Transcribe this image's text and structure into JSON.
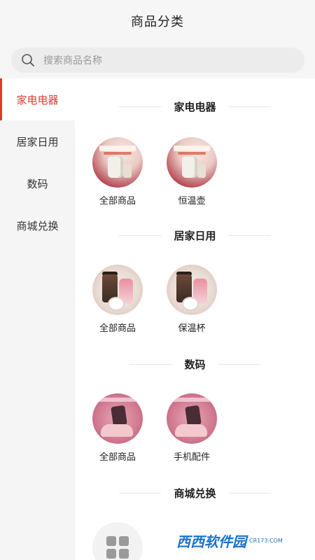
{
  "header": {
    "title": "商品分类"
  },
  "search": {
    "placeholder": "搜索商品名称",
    "icon": "search-icon"
  },
  "colors": {
    "accent": "#e0392b",
    "sidebar_bg": "#f5f5f5",
    "header_bg": "#f6f6f6"
  },
  "sidebar": {
    "items": [
      {
        "label": "家电电器",
        "active": true
      },
      {
        "label": "居家日用",
        "active": false
      },
      {
        "label": "数码",
        "active": false
      },
      {
        "label": "商城兑换",
        "active": false
      }
    ]
  },
  "sections": [
    {
      "title": "家电电器",
      "items": [
        {
          "label": "全部商品"
        },
        {
          "label": "恒温壶"
        }
      ]
    },
    {
      "title": "居家日用",
      "items": [
        {
          "label": "全部商品"
        },
        {
          "label": "保温杯"
        }
      ]
    },
    {
      "title": "数码",
      "items": [
        {
          "label": "全部商品"
        },
        {
          "label": "手机配件"
        }
      ]
    },
    {
      "title": "商城兑换",
      "items": [
        {
          "label": ""
        }
      ]
    }
  ],
  "watermark": {
    "logo": "西西软件园",
    "sub": "CR173.COM"
  }
}
